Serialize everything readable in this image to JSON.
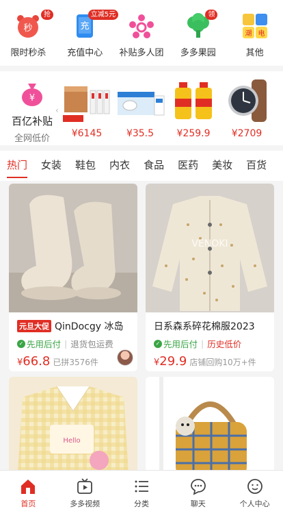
{
  "shortcuts": [
    {
      "label": "限时秒杀",
      "icon": "alarm-clock-icon",
      "icon_text": "秒",
      "badge": "抢"
    },
    {
      "label": "充值中心",
      "icon": "phone-recharge-icon",
      "icon_text": "充",
      "badge": "立减5元"
    },
    {
      "label": "补贴多人团",
      "icon": "group-people-icon",
      "badge": ""
    },
    {
      "label": "多多果园",
      "icon": "tree-icon",
      "badge": "领"
    },
    {
      "label": "其他",
      "icon": "app-grid-icon",
      "tiles": [
        "潮",
        "电"
      ],
      "badge": ""
    }
  ],
  "subsidy": {
    "title": "百亿补贴",
    "subtitle": "全网低价",
    "items": [
      {
        "name": "liquor-box-product",
        "price": "¥6145"
      },
      {
        "name": "milk-box-product",
        "price": "¥35.5"
      },
      {
        "name": "cooking-oil-product",
        "price": "¥259.9"
      },
      {
        "name": "watch-product",
        "price": "¥2709"
      }
    ]
  },
  "tabs": [
    "热门",
    "女装",
    "鞋包",
    "内衣",
    "食品",
    "医药",
    "美妆",
    "百货"
  ],
  "active_tab": 0,
  "products": [
    {
      "promo": "元旦大促",
      "title": "QinDocgy 冰岛",
      "tag_green": "先用后付",
      "tag_grey": "退货包运费",
      "price_symbol": "¥",
      "price": "66.8",
      "sales": "已拼3576件"
    },
    {
      "promo": "",
      "title": "日系森系碎花棉服2023",
      "tag_green": "先用后付",
      "tag_grey": "历史低价",
      "price_symbol": "¥",
      "price": "29.9",
      "sales": "店铺回购10万+件"
    }
  ],
  "product_image_text": {
    "jacket_watermark": "VENOKI",
    "tshirt_print": "Hello"
  },
  "nav": [
    {
      "label": "首页",
      "icon": "home-icon"
    },
    {
      "label": "多多视频",
      "icon": "video-tv-icon"
    },
    {
      "label": "分类",
      "icon": "category-list-icon"
    },
    {
      "label": "聊天",
      "icon": "chat-bubble-icon"
    },
    {
      "label": "个人中心",
      "icon": "profile-face-icon"
    }
  ],
  "colors": {
    "accent": "#e02e24",
    "green": "#3aa545"
  }
}
